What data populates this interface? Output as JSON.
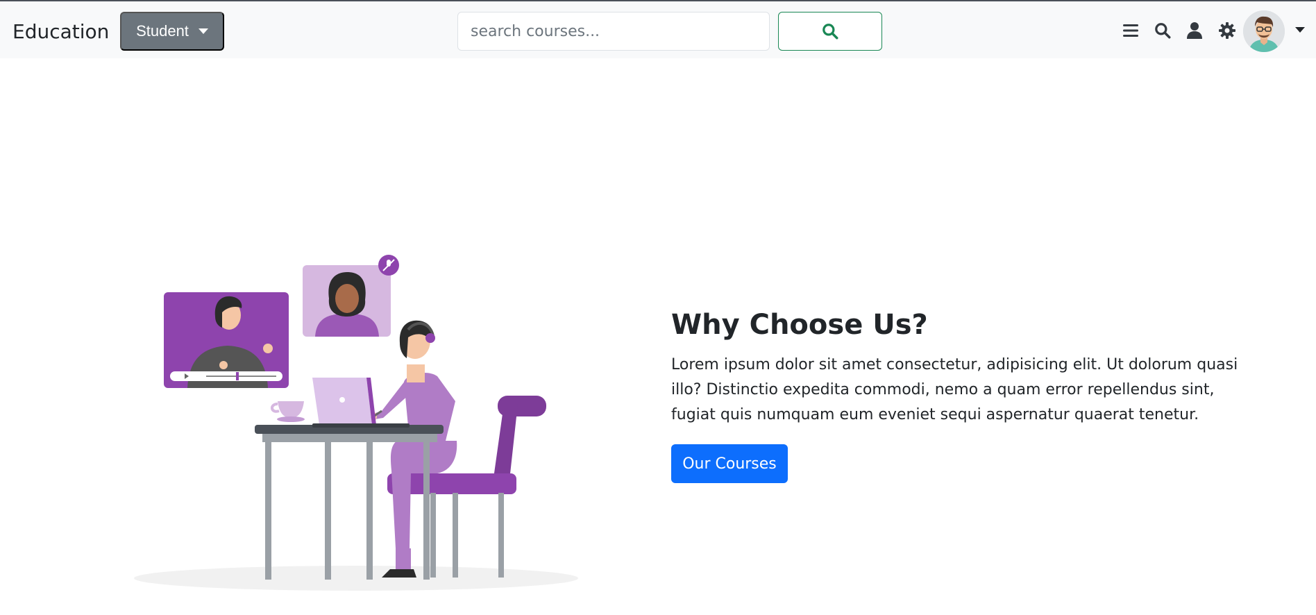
{
  "navbar": {
    "brand": "Education",
    "role_button_label": "Student",
    "search": {
      "placeholder": "search courses...",
      "value": ""
    }
  },
  "icons": {
    "search_button": "search-icon",
    "menu": "hamburger-menu-icon",
    "search": "search-icon",
    "profile": "user-icon",
    "settings": "gear-icon",
    "avatar": "user-avatar",
    "avatar_menu": "chevron-down-icon"
  },
  "hero": {
    "title": "Why Choose Us?",
    "body": "Lorem ipsum dolor sit amet consectetur, adipisicing elit. Ut dolorum quasi illo? Distinctio expedita commodi, nemo a quam error repellendus sint, fugiat quis numquam eum eveniet sequi aspernatur quaerat tenetur.",
    "cta_label": "Our Courses"
  },
  "colors": {
    "navbar_bg": "#f8f9fa",
    "secondary": "#6c757d",
    "success": "#198754",
    "primary": "#0d6efd",
    "illustration_purple": "#8e44ad",
    "illustration_lilac": "#c39bd3"
  }
}
